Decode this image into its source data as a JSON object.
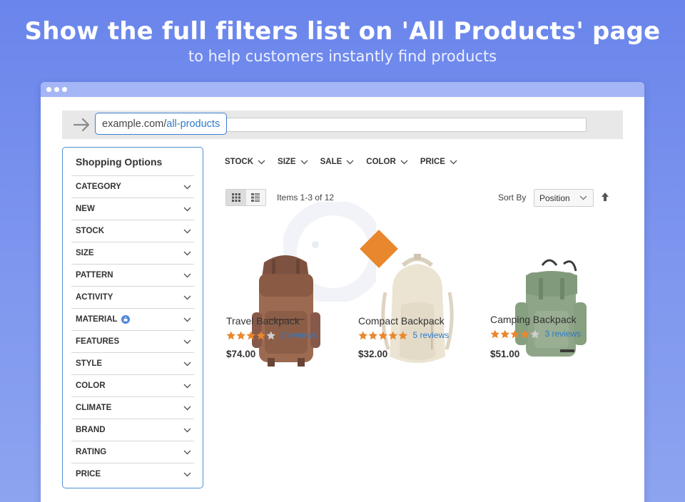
{
  "banner": {
    "headline": "Show the full filters list on 'All Products' page",
    "subline": "to help customers instantly find products"
  },
  "browser": {
    "url_domain": "example.com/",
    "url_path": "all-products"
  },
  "sidebar": {
    "title": "Shopping Options",
    "filters": [
      {
        "label": "CATEGORY"
      },
      {
        "label": "NEW"
      },
      {
        "label": "STOCK"
      },
      {
        "label": "SIZE"
      },
      {
        "label": "PATTERN"
      },
      {
        "label": "ACTIVITY"
      },
      {
        "label": "MATERIAL",
        "icon": "info-icon"
      },
      {
        "label": "FEATURES"
      },
      {
        "label": "STYLE"
      },
      {
        "label": "COLOR"
      },
      {
        "label": "CLIMATE"
      },
      {
        "label": "BRAND"
      },
      {
        "label": "RATING"
      },
      {
        "label": "PRICE"
      }
    ]
  },
  "top_filters": [
    "STOCK",
    "SIZE",
    "SALE",
    "COLOR",
    "PRICE"
  ],
  "toolbar": {
    "items_count": "Items 1-3 of 12",
    "sort_label": "Sort By",
    "sort_value": "Position"
  },
  "products": [
    {
      "name": "Travel Backpack",
      "rating": 4,
      "reviews": "2 reviews",
      "price": "$74.00",
      "color": "#9c6a50"
    },
    {
      "name": "Compact Backpack",
      "rating": 5,
      "reviews": "5 reviews",
      "price": "$32.00",
      "color": "#ece4d3"
    },
    {
      "name": "Camping Backpack",
      "rating": 4,
      "reviews": "3 reviews",
      "price": "$51.00",
      "color": "#8fa588"
    }
  ],
  "colors": {
    "accent_blue": "#2d7bc8",
    "star_filled": "#e8872d",
    "star_empty": "#cfcfcf",
    "banner_bg": "#6a85ec",
    "marker": "#e8872d"
  }
}
